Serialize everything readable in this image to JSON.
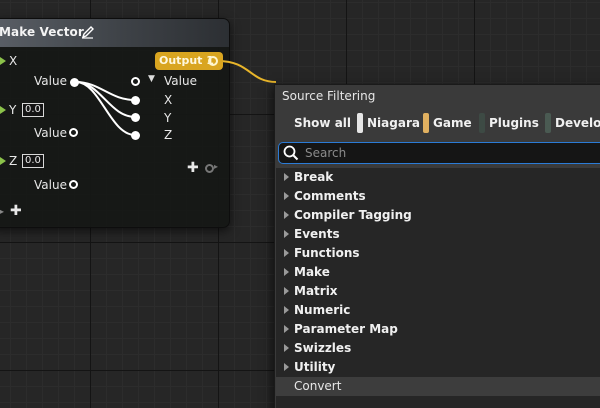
{
  "node": {
    "title": "Make Vector",
    "output_label": "Output 1",
    "pins": {
      "x_label": "X",
      "y_label": "Y",
      "z_label": "Z",
      "y_value": "0.0",
      "z_value": "0.0",
      "value_label": "Value",
      "struct_value_label": "Value",
      "sub_x": "X",
      "sub_y": "Y",
      "sub_z": "Z"
    },
    "accent_color": "#d9a520",
    "exec_color": "#8bc24a"
  },
  "menu": {
    "title": "Source Filtering",
    "filters": [
      {
        "label": "Show all",
        "color": ""
      },
      {
        "label": "Niagara",
        "color": "#e6e6e6"
      },
      {
        "label": "Game",
        "color": "#e0b060"
      },
      {
        "label": "Plugins",
        "color": "#3d4a44"
      },
      {
        "label": "Developer",
        "color": "#4a5a52"
      }
    ],
    "search": {
      "placeholder": "Search",
      "value": ""
    },
    "categories": [
      "Break",
      "Comments",
      "Compiler Tagging",
      "Events",
      "Functions",
      "Make",
      "Matrix",
      "Numeric",
      "Parameter Map",
      "Swizzles",
      "Utility"
    ],
    "convert_label": "Convert",
    "search_border_color": "#2b7bd6"
  }
}
